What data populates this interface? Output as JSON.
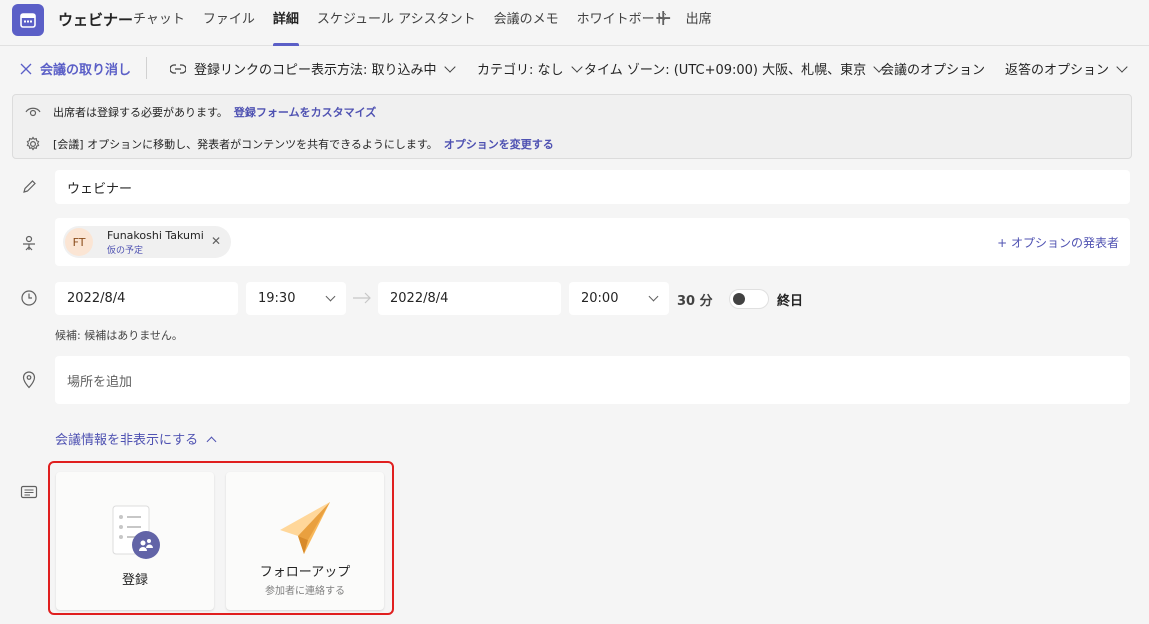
{
  "app": {
    "title": "ウェビナー"
  },
  "tabs": [
    {
      "label": "チャット"
    },
    {
      "label": "ファイル"
    },
    {
      "label": "詳細"
    },
    {
      "label": "スケジュール アシスタント"
    },
    {
      "label": "会議のメモ"
    },
    {
      "label": "ホワイトボード"
    },
    {
      "label": "出席"
    }
  ],
  "toolbar": {
    "cancel": "会議の取り消し",
    "copy_link": "登録リンクのコピー",
    "display": "表示方法: 取り込み中",
    "category": "カテゴリ: なし",
    "timezone": "タイム ゾーン: (UTC+09:00) 大阪、札幌、東京",
    "meeting_options": "会議のオプション",
    "response_options": "返答のオプション"
  },
  "banner": {
    "line1_text": "出席者は登録する必要があります。",
    "line1_link": "登録フォームをカスタマイズ",
    "line2_text": "[会議] オプションに移動し、発表者がコンテンツを共有できるようにします。",
    "line2_link": "オプションを変更する"
  },
  "form": {
    "title_value": "ウェビナー",
    "attendee": {
      "initials": "FT",
      "name": "Funakoshi Takumi",
      "status": "仮の予定"
    },
    "optional_presenter": "+ オプションの発表者",
    "start_date": "2022/8/4",
    "start_time": "19:30",
    "end_date": "2022/8/4",
    "end_time": "20:00",
    "duration": "30 分",
    "all_day": "終日",
    "all_day_on": false,
    "suggestion": "候補: 候補はありません。",
    "location_placeholder": "場所を追加",
    "hide_details": "会議情報を非表示にする"
  },
  "cards": {
    "registration": {
      "label": "登録"
    },
    "followup": {
      "label": "フォローアップ",
      "sub": "参加者に連絡する"
    }
  },
  "colors": {
    "accent": "#5b5fc7",
    "link": "#4f52b2",
    "highlight_border": "#e01f1f"
  }
}
